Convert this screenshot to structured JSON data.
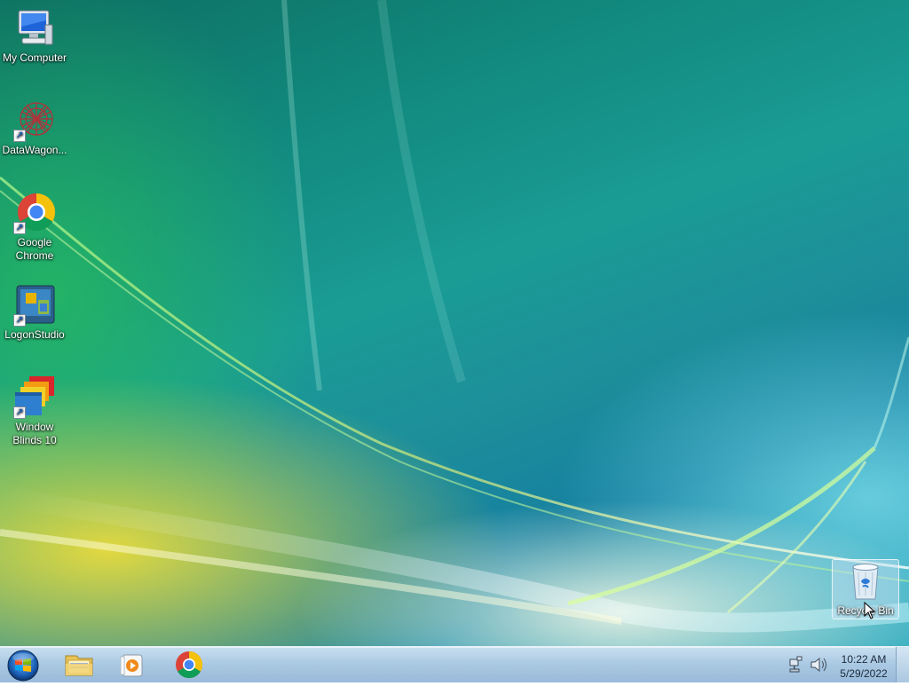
{
  "desktop_icons": [
    {
      "label": "My Computer",
      "icon": "computer-icon"
    },
    {
      "label": "DataWagon...",
      "icon": "datawagon-icon"
    },
    {
      "label": "Google Chrome",
      "icon": "chrome-icon"
    },
    {
      "label": "LogonStudio",
      "icon": "logonstudio-icon"
    },
    {
      "label": "Window Blinds 10",
      "icon": "windowblinds-icon"
    },
    {
      "label": "Recycle Bin",
      "icon": "recycle-bin-icon"
    }
  ],
  "taskbar": {
    "start": "start-orb-icon",
    "pinned": [
      "file-explorer-icon",
      "media-player-icon",
      "chrome-icon"
    ],
    "tray_icons": [
      "network-icon",
      "volume-icon"
    ],
    "clock": {
      "time": "10:22 AM",
      "date": "5/29/2022"
    }
  }
}
